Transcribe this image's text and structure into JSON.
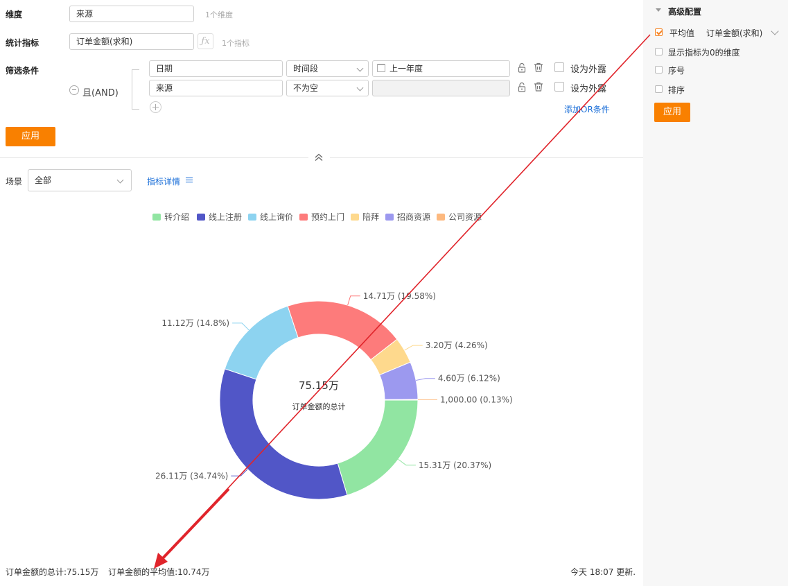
{
  "filters": {
    "dimension": {
      "label": "维度",
      "value": "来源",
      "hint": "1个维度"
    },
    "metric": {
      "label": "统计指标",
      "value": "订单金额(求和)",
      "hint": "1个指标"
    },
    "conditions": {
      "label": "筛选条件",
      "logic": "且(AND)",
      "rows": [
        {
          "field": "日期",
          "operator": "时间段",
          "value": "上一年度",
          "expose_label": "设为外露"
        },
        {
          "field": "来源",
          "operator": "不为空",
          "value": "",
          "expose_label": "设为外露"
        }
      ],
      "add_or": "添加OR条件"
    },
    "apply": "应用"
  },
  "scene": {
    "label": "场景",
    "value": "全部",
    "metric_detail": "指标详情"
  },
  "advanced": {
    "title": "高级配置",
    "options": [
      {
        "label": "平均值",
        "checked": true,
        "select": "订单金额(求和)"
      },
      {
        "label": "显示指标为0的维度",
        "checked": false
      },
      {
        "label": "序号",
        "checked": false
      },
      {
        "label": "排序",
        "checked": false
      }
    ],
    "apply": "应用"
  },
  "chart_data": {
    "type": "pie",
    "center_value": "75.15万",
    "center_label": "订单金额的总计",
    "slices": [
      {
        "name": "转介绍",
        "value": 15.31,
        "label": "15.31万 (20.37%)",
        "color": "#91e5a2"
      },
      {
        "name": "线上注册",
        "value": 26.11,
        "label": "26.11万 (34.74%)",
        "color": "#5156c7"
      },
      {
        "name": "线上询价",
        "value": 11.12,
        "label": "11.12万 (14.8%)",
        "color": "#8dd3f0"
      },
      {
        "name": "预约上门",
        "value": 14.71,
        "label": "14.71万 (19.58%)",
        "color": "#fd7b7b"
      },
      {
        "name": "陪拜",
        "value": 3.2,
        "label": "3.20万 (4.26%)",
        "color": "#fed98d"
      },
      {
        "name": "招商资源",
        "value": 4.6,
        "label": "4.60万 (6.12%)",
        "color": "#9c99ef"
      },
      {
        "name": "公司资源",
        "value": 0.1,
        "label": "1,000.00 (0.13%)",
        "color": "#fdb97f"
      }
    ]
  },
  "footer": {
    "total": "订单金额的总计:75.15万",
    "average": "订单金额的平均值:10.74万",
    "updated": "今天 18:07 更新."
  }
}
